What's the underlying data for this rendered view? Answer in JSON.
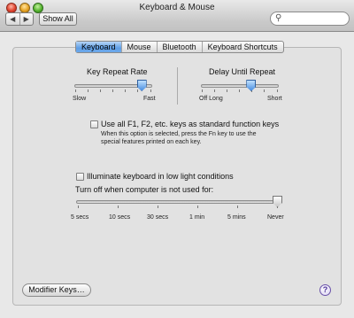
{
  "window": {
    "title": "Keyboard & Mouse"
  },
  "toolbar": {
    "back_icon": "◀",
    "forward_icon": "▶",
    "show_all_label": "Show All",
    "search_value": "",
    "search_icon": "🔍"
  },
  "tabs": [
    {
      "label": "Keyboard",
      "selected": true
    },
    {
      "label": "Mouse",
      "selected": false
    },
    {
      "label": "Bluetooth",
      "selected": false
    },
    {
      "label": "Keyboard Shortcuts",
      "selected": false
    }
  ],
  "key_repeat": {
    "title": "Key Repeat Rate",
    "min_label": "Slow",
    "max_label": "Fast",
    "level": 0.86
  },
  "delay_repeat": {
    "title": "Delay Until Repeat",
    "min_label": "Off Long",
    "max_label": "Short",
    "level": 0.64
  },
  "fn_keys": {
    "label": "Use all F1, F2, etc. keys as standard function keys",
    "checked": false,
    "note_line1": "When this option is selected, press the Fn key to use the",
    "note_line2": "special features printed on each key."
  },
  "illuminate": {
    "label": "Illuminate keyboard in low light conditions",
    "checked": false,
    "turn_off_label": "Turn off when computer is not used for:",
    "ticks": [
      "5 secs",
      "10 secs",
      "30 secs",
      "1 min",
      "5 mins",
      "Never"
    ],
    "selected_index": 5
  },
  "footer": {
    "modifier_keys_label": "Modifier Keys…",
    "help_label": "?"
  }
}
